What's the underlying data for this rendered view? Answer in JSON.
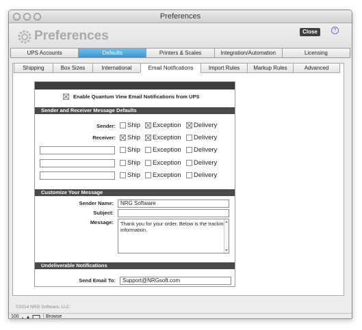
{
  "window": {
    "title": "Preferences"
  },
  "header": {
    "title": "Preferences",
    "close_label": "Close",
    "help_label": "?"
  },
  "main_tabs": [
    {
      "label": "UPS Accounts"
    },
    {
      "label": "Defaults"
    },
    {
      "label": "Printers & Scales"
    },
    {
      "label": "Integration/Automation"
    },
    {
      "label": "Licensing"
    }
  ],
  "sub_tabs": [
    {
      "label": "Shipping"
    },
    {
      "label": "Box Sizes"
    },
    {
      "label": "International"
    },
    {
      "label": "Email Notifications"
    },
    {
      "label": "Import Rules"
    },
    {
      "label": "Markup Rules"
    },
    {
      "label": "Advanced"
    }
  ],
  "enable": {
    "label": "Enable Quantum View Email Notifications from UPS",
    "checked": true
  },
  "sections": {
    "sender_receiver": "Sender and Receiver Message Defaults",
    "customize": "Customize Your Message",
    "undeliverable": "Undeliverable Notifications"
  },
  "notification_options": {
    "ship": "Ship",
    "exception": "Exception",
    "delivery": "Delivery"
  },
  "rows": [
    {
      "label": "Sender:",
      "ship": false,
      "exception": true,
      "delivery": true
    },
    {
      "label": "Receiver:",
      "ship": true,
      "exception": true,
      "delivery": false
    },
    {
      "label": "",
      "ship": false,
      "exception": false,
      "delivery": false
    },
    {
      "label": "",
      "ship": false,
      "exception": false,
      "delivery": false
    },
    {
      "label": "",
      "ship": false,
      "exception": false,
      "delivery": false
    }
  ],
  "message": {
    "sender_name_label": "Sender Name:",
    "sender_name_value": "NRG Software",
    "subject_label": "Subject:",
    "subject_value": "",
    "message_label": "Message:",
    "message_value": "Thank you for your order.  Below is the tracking information."
  },
  "undeliverable": {
    "send_email_label": "Send Email To:",
    "email_value": "Support@NRGsoft.com"
  },
  "footer": {
    "copyright": "©2014 NRG Software, LLC."
  },
  "statusbar": {
    "zoom": "100",
    "mode": "Browse"
  },
  "colors": {
    "accent_tab": "#3996d6",
    "section_bar": "#4a4a4a"
  }
}
